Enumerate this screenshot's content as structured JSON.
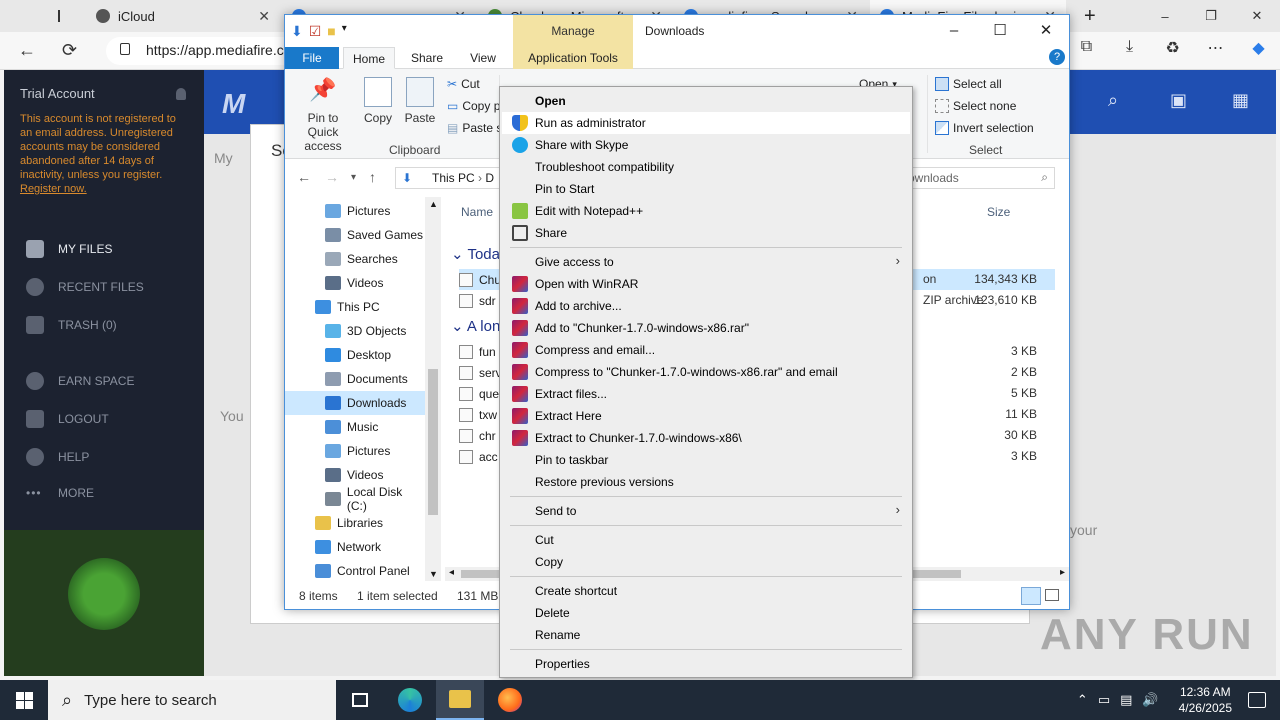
{
  "browser": {
    "tabs": [
      {
        "label": "iCloud"
      },
      {
        "label": "s...",
        "partial": true
      },
      {
        "label": "Chunker - Minecraft",
        "partial": true
      },
      {
        "label": "mediafire - Search",
        "partial": true
      },
      {
        "label": "MediaFire File sharing",
        "partial": true
      }
    ],
    "new_tab": "+",
    "address": "https://app.mediafire.c",
    "window_controls": {
      "minimize": "–",
      "restore": "❐",
      "close": "✕"
    }
  },
  "mediafire": {
    "sidebar": {
      "account_title": "Trial Account",
      "warning_text": "This account is not registered to an email address. Unregistered accounts may be considered abandoned after 14 days of inactivity, unless you register.",
      "register_link": "Register now.",
      "nav": [
        {
          "label": "MY FILES",
          "icon": "folder-icon",
          "active": true
        },
        {
          "label": "RECENT FILES",
          "icon": "clock-icon"
        },
        {
          "label": "TRASH (0)",
          "icon": "trash-icon"
        },
        {
          "label": "EARN SPACE",
          "icon": "plus-circle-icon"
        },
        {
          "label": "LOGOUT",
          "icon": "logout-icon"
        },
        {
          "label": "HELP",
          "icon": "help-icon"
        },
        {
          "label": "MORE",
          "icon": "more-icon"
        }
      ]
    },
    "header": {
      "logo": "M"
    },
    "dialog": {
      "title_partial": "Se"
    },
    "bg_text_left": "You",
    "bg_text_right": "your",
    "breadcrumb_partial": "My"
  },
  "explorer": {
    "title": "Downloads",
    "contextual_tab_group": "Manage",
    "ribbon_tabs": [
      "File",
      "Home",
      "Share",
      "View",
      "Application Tools"
    ],
    "ribbon": {
      "pin_label": "Pin to Quick access",
      "copy_label": "Copy",
      "paste_label": "Paste",
      "cut_label": "Cut",
      "copy_path_label": "Copy p",
      "paste_shortcut_label": "Paste s",
      "clipboard_group": "Clipboard",
      "open_label": "Open",
      "select_all": "Select all",
      "select_none": "Select none",
      "invert_selection": "Invert selection",
      "select_group": "Select"
    },
    "path": [
      "This PC",
      "D"
    ],
    "search_placeholder": "ownloads",
    "nav_pane": [
      {
        "label": "Pictures",
        "indent": 2,
        "color": "#6aa7e0"
      },
      {
        "label": "Saved Games",
        "indent": 2,
        "color": "#7a8ea6"
      },
      {
        "label": "Searches",
        "indent": 2,
        "color": "#9aa8b8"
      },
      {
        "label": "Videos",
        "indent": 2,
        "color": "#5a6e88"
      },
      {
        "label": "This PC",
        "indent": 1,
        "color": "#3d8fe0"
      },
      {
        "label": "3D Objects",
        "indent": 2,
        "color": "#58b3e8"
      },
      {
        "label": "Desktop",
        "indent": 2,
        "color": "#2f8be0"
      },
      {
        "label": "Documents",
        "indent": 2,
        "color": "#8e9cb0"
      },
      {
        "label": "Downloads",
        "indent": 2,
        "color": "#2a74d2",
        "selected": true
      },
      {
        "label": "Music",
        "indent": 2,
        "color": "#4c8fd8"
      },
      {
        "label": "Pictures",
        "indent": 2,
        "color": "#6aa7e0"
      },
      {
        "label": "Videos",
        "indent": 2,
        "color": "#5a6e88"
      },
      {
        "label": "Local Disk (C:)",
        "indent": 2,
        "color": "#7a8794"
      },
      {
        "label": "Libraries",
        "indent": 1,
        "color": "#e9c24a"
      },
      {
        "label": "Network",
        "indent": 1,
        "color": "#3d8fe0"
      },
      {
        "label": "Control Panel",
        "indent": 1,
        "color": "#4a8ed8"
      }
    ],
    "columns": {
      "name": "Name",
      "size": "Size"
    },
    "groups": [
      {
        "label": "Today",
        "rows": [
          {
            "name": "Chu",
            "type": "on",
            "size": "134,343 KB",
            "selected": true
          },
          {
            "name": "sdr",
            "type": "ZIP archive",
            "size": "123,610 KB"
          }
        ]
      },
      {
        "label": "A lon",
        "rows": [
          {
            "name": "fun",
            "type": "",
            "size": "3 KB"
          },
          {
            "name": "serv",
            "type": "",
            "size": "2 KB"
          },
          {
            "name": "que",
            "type": "",
            "size": "5 KB"
          },
          {
            "name": "txw",
            "type": "",
            "size": "11 KB"
          },
          {
            "name": "chr",
            "type": "",
            "size": "30 KB"
          },
          {
            "name": "acc",
            "type": "",
            "size": "3 KB"
          }
        ]
      }
    ],
    "status": {
      "count": "8 items",
      "selection": "1 item selected",
      "size": "131 MB"
    }
  },
  "context_menu": {
    "items": [
      {
        "label": "Open",
        "bold": true
      },
      {
        "label": "Run as administrator",
        "icon": "shield-icon",
        "hover": true
      },
      {
        "label": "Share with Skype",
        "icon": "skype-icon"
      },
      {
        "label": "Troubleshoot compatibility"
      },
      {
        "label": "Pin to Start"
      },
      {
        "label": "Edit with Notepad++",
        "icon": "notepad-plus-icon"
      },
      {
        "label": "Share",
        "icon": "share-icon"
      },
      {
        "sep": true
      },
      {
        "label": "Give access to",
        "submenu": true
      },
      {
        "label": "Open with WinRAR",
        "icon": "winrar-icon"
      },
      {
        "label": "Add to archive...",
        "icon": "winrar-icon"
      },
      {
        "label": "Add to \"Chunker-1.7.0-windows-x86.rar\"",
        "icon": "winrar-icon"
      },
      {
        "label": "Compress and email...",
        "icon": "winrar-icon"
      },
      {
        "label": "Compress to \"Chunker-1.7.0-windows-x86.rar\" and email",
        "icon": "winrar-icon"
      },
      {
        "label": "Extract files...",
        "icon": "winrar-icon"
      },
      {
        "label": "Extract Here",
        "icon": "winrar-icon"
      },
      {
        "label": "Extract to Chunker-1.7.0-windows-x86\\",
        "icon": "winrar-icon"
      },
      {
        "label": "Pin to taskbar"
      },
      {
        "label": "Restore previous versions"
      },
      {
        "sep": true
      },
      {
        "label": "Send to",
        "submenu": true
      },
      {
        "sep": true
      },
      {
        "label": "Cut"
      },
      {
        "label": "Copy"
      },
      {
        "sep": true
      },
      {
        "label": "Create shortcut"
      },
      {
        "label": "Delete"
      },
      {
        "label": "Rename"
      },
      {
        "sep": true
      },
      {
        "label": "Properties"
      }
    ]
  },
  "taskbar": {
    "search_placeholder": "Type here to search",
    "apps": [
      "task-view-icon",
      "edge-icon",
      "file-explorer-icon",
      "firefox-icon"
    ],
    "clock_time": "12:36 AM",
    "clock_date": "4/26/2025"
  },
  "watermark": "ANY RUN"
}
